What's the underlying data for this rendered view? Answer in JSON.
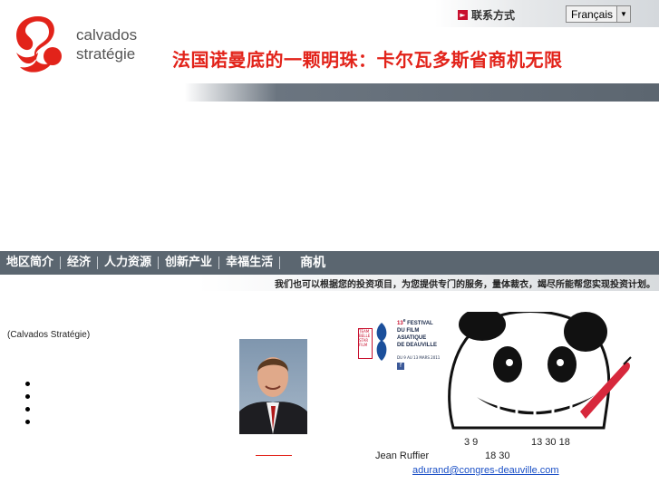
{
  "header": {
    "logo_line1": "calvados",
    "logo_line2": "stratégie",
    "contact_label": "联系方式",
    "language_selected": "Français",
    "tagline": "法国诺曼底的一颗明珠：卡尔瓦多斯省商机无限"
  },
  "nav": {
    "items": [
      "地区简介",
      "经济",
      "人力资源",
      "创新产业",
      "幸福生活",
      "商机"
    ],
    "subtitle": "我们也可以根据您的投资项目，为您提供专门的服务，量体裁衣，竭尽所能帮您实现投资计划。"
  },
  "content": {
    "intro": "(Calvados Stratégie)",
    "bullet_count": 4
  },
  "poster": {
    "festival_number": "13",
    "festival_sup": "e",
    "festival_line1": "FESTIVAL",
    "festival_line2": "DU FILM",
    "festival_line3": "ASIATIQUE",
    "festival_line4": "DE DEAUVILLE",
    "dates": "DU 9 AU 13 MARS 2011",
    "logo_text": "TEAM BELLE STAR FILM",
    "fb": "f"
  },
  "event_info": {
    "dates_a": "3 9",
    "dates_b": "13 30 18",
    "contact_name": "Jean Ruffier",
    "time": "18 30",
    "email": "adurand@congres-deauville.com"
  },
  "colors": {
    "brand_red": "#e2231a",
    "nav_bg": "#5b6670",
    "link": "#1a4fc6"
  }
}
